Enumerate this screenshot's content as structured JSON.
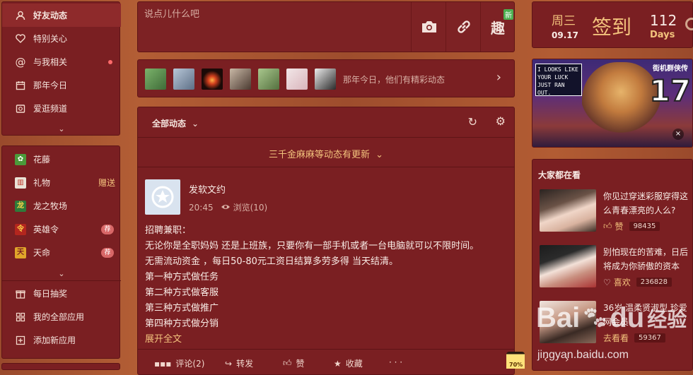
{
  "nav": {
    "items": [
      {
        "label": "好友动态",
        "icon": "friends-icon"
      },
      {
        "label": "特别关心",
        "icon": "heart-icon"
      },
      {
        "label": "与我相关",
        "icon": "at-icon"
      },
      {
        "label": "那年今日",
        "icon": "calendar-icon"
      },
      {
        "label": "爱逛频道",
        "icon": "browse-icon"
      }
    ],
    "apps": [
      {
        "label": "花藤",
        "icon": "flower-vine-icon"
      },
      {
        "label": "礼物",
        "icon": "gift-icon",
        "extra": "赠送"
      },
      {
        "label": "龙之牧场",
        "icon": "dragon-ranch-icon"
      },
      {
        "label": "英雄令",
        "icon": "hero-order-icon",
        "badge": "荐"
      },
      {
        "label": "天命",
        "icon": "destiny-icon",
        "badge": "荐"
      }
    ],
    "tools": [
      {
        "label": "每日抽奖",
        "icon": "lottery-gift-icon"
      },
      {
        "label": "我的全部应用",
        "icon": "apps-grid-icon"
      },
      {
        "label": "添加新应用",
        "icon": "add-app-icon"
      }
    ]
  },
  "composer": {
    "placeholder": "说点儿什么吧",
    "fun_label": "趣",
    "new_badge": "新"
  },
  "history": {
    "text": "那年今日，他们有精彩动态"
  },
  "feed": {
    "filter_label": "全部动态",
    "update_notice": "三千金麻麻等动态有更新",
    "post": {
      "author": "发软文约",
      "time": "20:45",
      "views": "浏览(10)",
      "lines": [
        "招聘兼职：",
        "无论你是全职妈妈 还是上班族，只要你有一部手机或者一台电脑就可以不限时间。",
        "无需流动资金 ，每日50-80元工资日结算多劳多得 当天结清。",
        "第一种方式做任务",
        "第二种方式做客服",
        "第三种方式做推广",
        "第四种方式做分销"
      ],
      "expand": "展开全文",
      "actions": {
        "comment": "评论(2)",
        "repost": "转发",
        "like": "赞",
        "favorite": "收藏"
      }
    }
  },
  "checkin": {
    "weekday": "周三",
    "date": "09.17",
    "button": "签到",
    "days_count": "112",
    "days_label": "Days"
  },
  "game_ad": {
    "speech": "I LOOKS LIKE YOUR LUCK JUST RAN OUT.",
    "title": "街机群侠传",
    "score": "17"
  },
  "trending": {
    "title": "大家都在看",
    "items": [
      {
        "title": "你见过穿迷彩服穿得这么青春漂亮的人么?",
        "action": "赞",
        "count": "98435"
      },
      {
        "title": "别怕现在的苦难，日后将成为你骄傲的资本",
        "action": "喜欢",
        "count": "236828"
      },
      {
        "title": "36岁 温柔贤淑型 珍爱网会员",
        "action": "去看看",
        "count": "59367"
      }
    ]
  },
  "watermark": {
    "brand": "Bai",
    "brand2": "du",
    "brand_cn": "经验",
    "url": "jingyan.baidu.com"
  },
  "lamp": {
    "percent": "70%"
  },
  "colors": {
    "panel": "#7a1f22",
    "accent": "#f3c37d",
    "background": "#a55430"
  }
}
